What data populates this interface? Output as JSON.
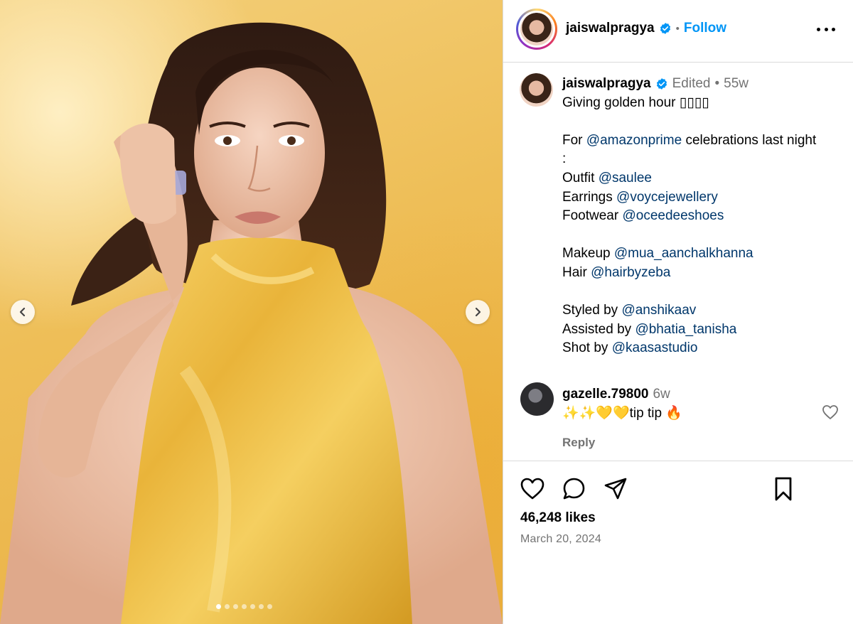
{
  "header": {
    "username": "jaiswalpragya",
    "separator": "•",
    "follow_label": "Follow"
  },
  "caption": {
    "username": "jaiswalpragya",
    "edited": "Edited",
    "dot": "•",
    "age": "55w",
    "lines": [
      {
        "text": "Giving golden hour ",
        "mention": "",
        "suffix": "▯▯▯▯"
      },
      {
        "text": "",
        "mention": "",
        "suffix": ""
      },
      {
        "text": "For ",
        "mention": "@amazonprime",
        "suffix": " celebrations last night"
      },
      {
        "text": ":",
        "mention": "",
        "suffix": ""
      },
      {
        "text": "Outfit ",
        "mention": "@saulee",
        "suffix": ""
      },
      {
        "text": "Earrings ",
        "mention": "@voycejewellery",
        "suffix": ""
      },
      {
        "text": "Footwear ",
        "mention": "@oceedeeshoes",
        "suffix": ""
      },
      {
        "text": "",
        "mention": "",
        "suffix": ""
      },
      {
        "text": "Makeup ",
        "mention": "@mua_aanchalkhanna",
        "suffix": ""
      },
      {
        "text": "Hair ",
        "mention": "@hairbyzeba",
        "suffix": ""
      },
      {
        "text": "",
        "mention": "",
        "suffix": ""
      },
      {
        "text": "Styled by ",
        "mention": "@anshikaav",
        "suffix": ""
      },
      {
        "text": "Assisted by ",
        "mention": "@bhatia_tanisha",
        "suffix": ""
      },
      {
        "text": "Shot by ",
        "mention": "@kaasastudio",
        "suffix": ""
      }
    ]
  },
  "comment": {
    "username": "gazelle.79800",
    "age": "6w",
    "text": "✨✨💛💛tip tip 🔥",
    "reply_label": "Reply"
  },
  "actions": {
    "icons": [
      "heart-icon",
      "comment-icon",
      "share-icon",
      "bookmark-icon"
    ]
  },
  "likes": "46,248 likes",
  "date": "March 20, 2024",
  "carousel": {
    "total": 7,
    "active_index": 0
  },
  "colors": {
    "follow": "#0095f6",
    "mention": "#00376b",
    "verified": "#0095f6",
    "muted": "#737373"
  }
}
